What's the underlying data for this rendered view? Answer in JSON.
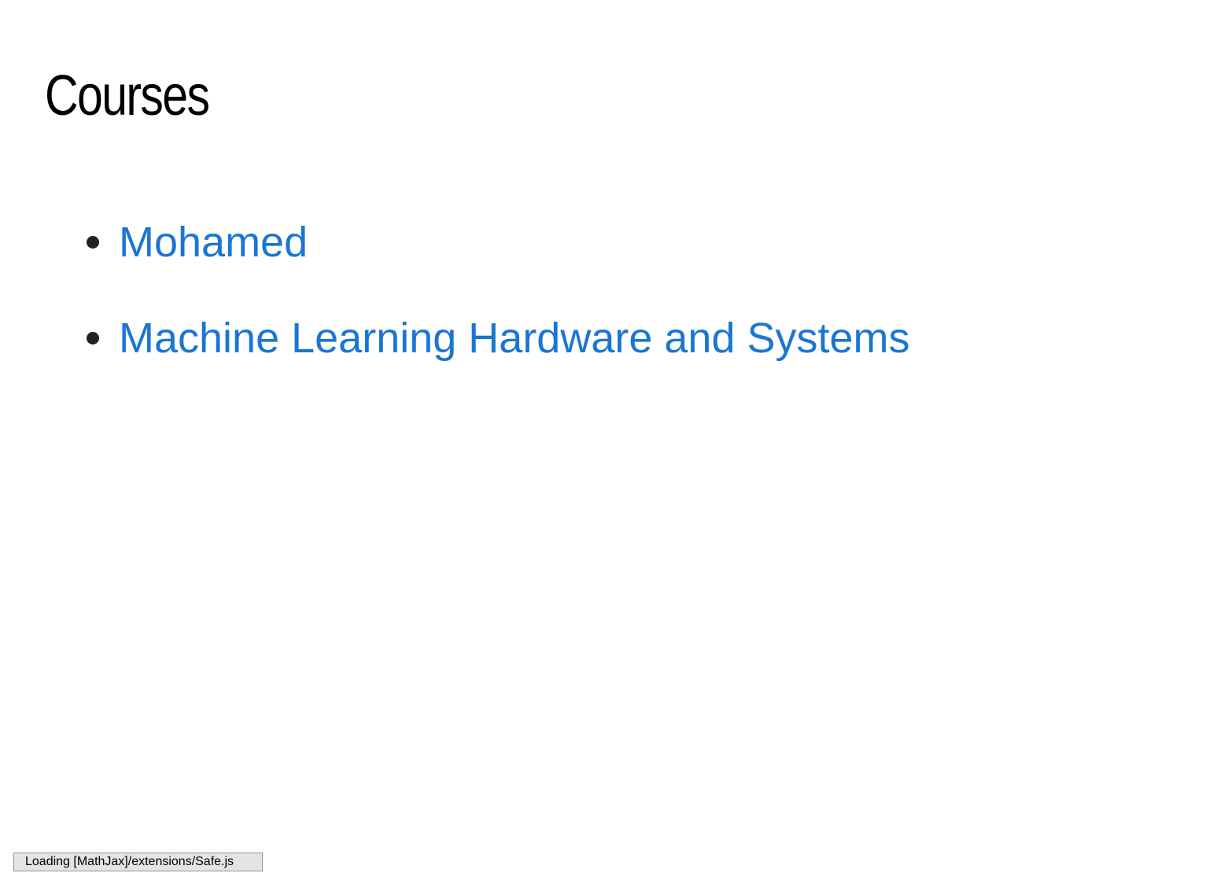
{
  "page": {
    "title": "Courses"
  },
  "courses": [
    {
      "label": "Mohamed"
    },
    {
      "label": "Machine Learning Hardware and Systems"
    }
  ],
  "status": {
    "message": "Loading [MathJax]/extensions/Safe.js"
  },
  "colors": {
    "link": "#1a76d2",
    "title": "#000000",
    "bullet": "#222222",
    "status_bg": "#e4e4e4"
  }
}
